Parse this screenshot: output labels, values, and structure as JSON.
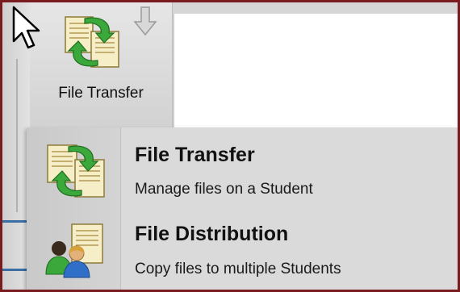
{
  "toolbar": {
    "file_transfer_button": {
      "label": "File Transfer",
      "icon": "file-transfer-icon"
    },
    "dropdown_arrow_icon": "down-arrow-icon"
  },
  "menu": {
    "items": [
      {
        "title": "File Transfer",
        "description": "Manage files on a Student",
        "icon": "file-transfer-icon"
      },
      {
        "title": "File Distribution",
        "description": "Copy files to multiple Students",
        "icon": "file-distribution-icon"
      }
    ]
  },
  "colors": {
    "frame_border": "#7a1c1f",
    "menu_background": "#dadada",
    "toolbar_background": "#d6d6d6",
    "arrow_green": "#3aa83a"
  }
}
